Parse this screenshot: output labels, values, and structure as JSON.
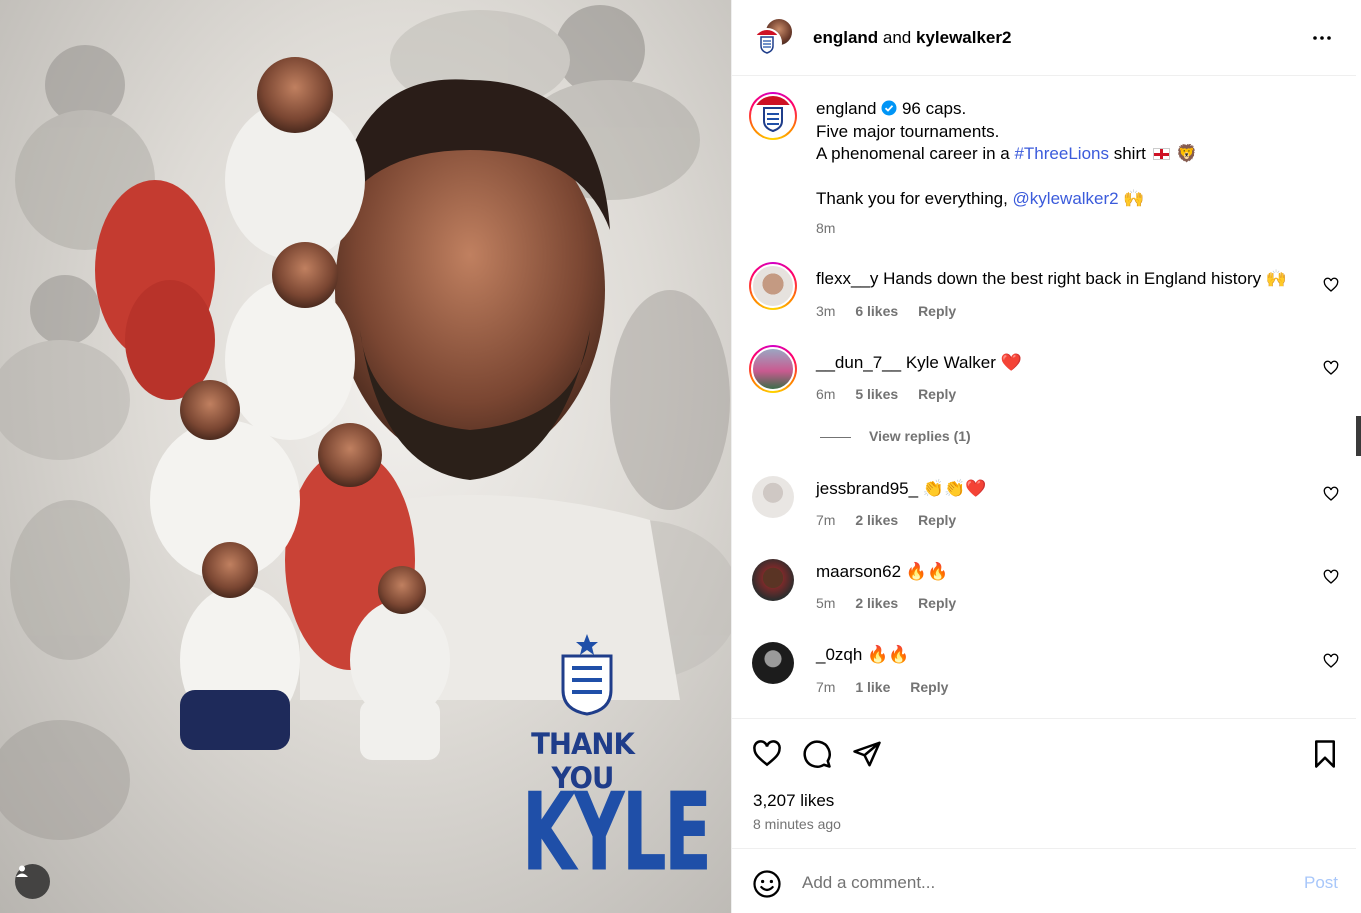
{
  "header": {
    "user1": "england",
    "conjunction": " and ",
    "user2": "kylewalker2",
    "more_icon": "more-horizontal-icon"
  },
  "caption": {
    "username": "england",
    "verified": true,
    "line1": " 96 caps.",
    "line2": "Five major tournaments.",
    "line3_pre": "A phenomenal career in a ",
    "hashtag": "#ThreeLions",
    "line3_post": " shirt",
    "line3_emoji": "🦁",
    "line4_pre": "Thank you for everything, ",
    "mention": "@kylewalker2",
    "line4_emoji": "🙌",
    "time": "8m"
  },
  "comments": [
    {
      "username": "flexx__y",
      "text": " Hands down the best right back in England history 🙌",
      "time": "3m",
      "likes": "6 likes",
      "reply": "Reply"
    },
    {
      "username": "__dun_7__",
      "text": " Kyle Walker ❤️",
      "time": "6m",
      "likes": "5 likes",
      "reply": "Reply"
    },
    {
      "username": "jessbrand95_",
      "text": " 👏👏❤️",
      "time": "7m",
      "likes": "2 likes",
      "reply": "Reply"
    },
    {
      "username": "maarson62",
      "text": " 🔥🔥",
      "time": "5m",
      "likes": "2 likes",
      "reply": "Reply"
    },
    {
      "username": "_0zqh",
      "text": " 🔥🔥",
      "time": "7m",
      "likes": "1 like",
      "reply": "Reply"
    }
  ],
  "view_replies": "View replies (1)",
  "actions": {
    "like_icon": "heart-icon",
    "comment_icon": "comment-icon",
    "share_icon": "send-icon",
    "save_icon": "bookmark-icon",
    "likes": "3,207 likes",
    "time_ago": "8 minutes ago"
  },
  "comment_box": {
    "placeholder": "Add a comment...",
    "post_label": "Post",
    "emoji_icon": "emoji-icon"
  },
  "media": {
    "headline": "THANK YOU",
    "name": "KYLE",
    "user_tag_icon": "user-icon",
    "accent": "#1f4fa8"
  }
}
